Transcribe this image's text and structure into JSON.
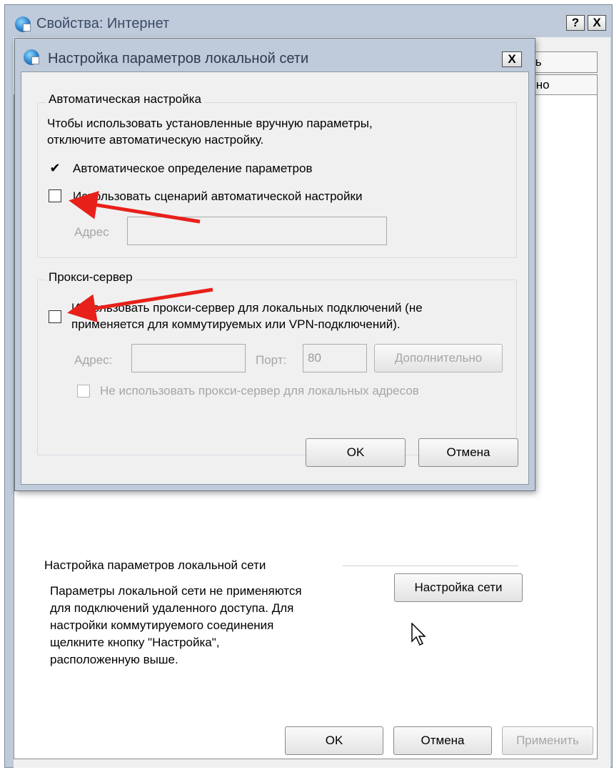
{
  "outer_window": {
    "title": "Свойства: Интернет",
    "help_btn": "?",
    "close_btn": "X",
    "tabs": [
      "ть",
      "льно"
    ],
    "lan_settings": {
      "title": "Настройка параметров локальной сети",
      "description_lines": [
        "Параметры локальной сети не применяются",
        "для подключений удаленного доступа. Для",
        "настройки коммутируемого соединения",
        "щелкните кнопку \"Настройка\",",
        "расположенную выше."
      ],
      "network_button": "Настройка сети"
    },
    "buttons": {
      "ok": "OK",
      "cancel": "Отмена",
      "apply": "Применить"
    }
  },
  "lan_dialog": {
    "title": "Настройка параметров локальной сети",
    "close_btn": "X",
    "auto_config": {
      "group_title": "Автоматическая настройка",
      "description_lines": [
        "Чтобы использовать установленные вручную параметры,",
        "отключите автоматическую настройку."
      ],
      "auto_detect": {
        "label": "Автоматическое определение параметров",
        "checked": true,
        "mark": "✔"
      },
      "use_script": {
        "label": "Использовать сценарий автоматической настройки",
        "checked": false
      },
      "address_label": "Адрес",
      "address_value": ""
    },
    "proxy": {
      "group_title": "Прокси-сервер",
      "use_proxy": {
        "label_lines": [
          "Использовать прокси-сервер для локальных подключений (не",
          "применяется для коммутируемых или VPN-подключений)."
        ],
        "checked": false
      },
      "address_label": "Адрес:",
      "address_value": "",
      "port_label": "Порт:",
      "port_value": "80",
      "advanced_button": "Дополнительно",
      "bypass_local": {
        "label": "Не использовать прокси-сервер для локальных адресов",
        "checked": false
      }
    },
    "buttons": {
      "ok": "OK",
      "cancel": "Отмена"
    }
  },
  "annotations": {
    "arrow_color": "#e8201a"
  }
}
